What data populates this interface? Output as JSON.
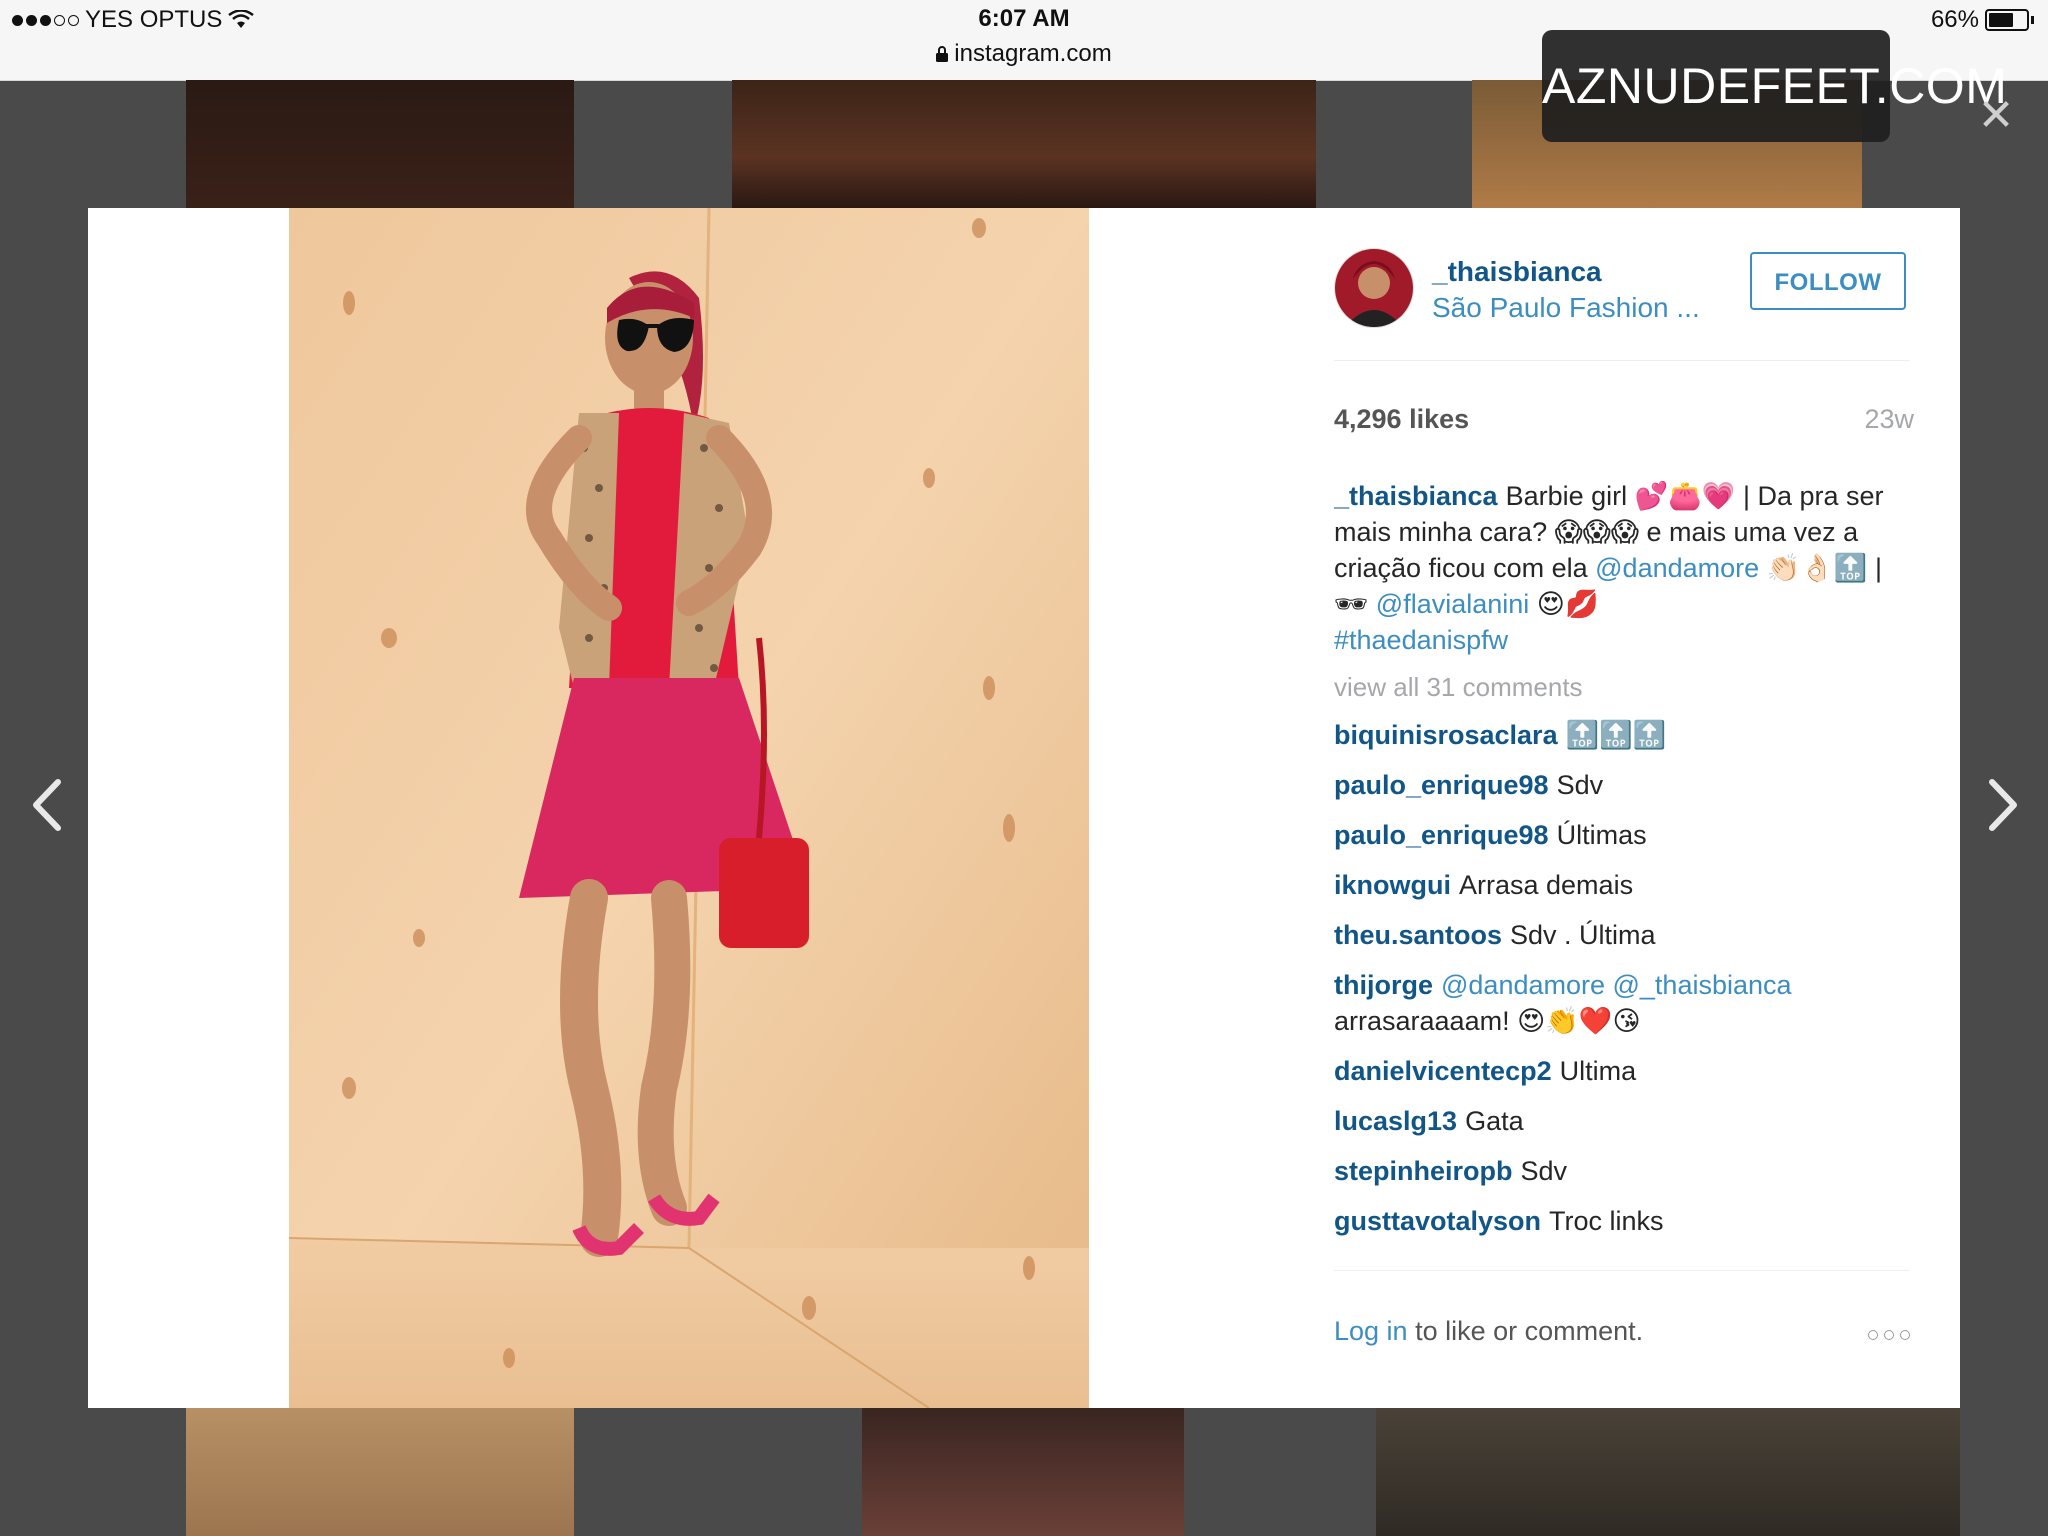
{
  "status_bar": {
    "carrier": "YES OPTUS",
    "time": "6:07 AM",
    "url": "instagram.com",
    "battery": "66%",
    "battery_level": 0.66
  },
  "watermark": "AZNUDEFEET.COM",
  "post": {
    "username": "_thaisbianca",
    "location": "São Paulo Fashion ...",
    "follow_label": "FOLLOW",
    "likes": "4,296 likes",
    "age": "23w",
    "caption": {
      "user": "_thaisbianca",
      "text_1": "Barbie girl 💕👛💗 | Da pra ser mais minha cara? 😱😱😱 e mais uma vez a criação ficou com ela",
      "mention_1": "@dandamore",
      "text_2": "👏🏻👌🏻🔝 | 🕶",
      "mention_2": "@flavialanini",
      "text_3": "😍💋",
      "hashtag": "#thaedanispfw"
    },
    "view_all": "view all 31 comments",
    "comments": [
      {
        "user": "biquinisrosaclara",
        "text": "🔝🔝🔝"
      },
      {
        "user": "paulo_enrique98",
        "text": "Sdv"
      },
      {
        "user": "paulo_enrique98",
        "text": "Últimas"
      },
      {
        "user": "iknowgui",
        "text": "Arrasa demais"
      },
      {
        "user": "theu.santoos",
        "text": "Sdv . Última"
      },
      {
        "user": "thijorge",
        "mention": "@dandamore @_thaisbianca",
        "text": "arrasaraaaam! 😍👏❤️😘"
      },
      {
        "user": "danielvicentecp2",
        "text": "Ultima"
      },
      {
        "user": "lucaslg13",
        "text": "Gata"
      },
      {
        "user": "stepinheiropb",
        "text": "Sdv"
      },
      {
        "user": "gusttavotalyson",
        "text": "Troc links"
      }
    ],
    "login_link": "Log in",
    "login_rest": "to like or comment."
  },
  "icons": {
    "prev": "chevron-left-icon",
    "next": "chevron-right-icon",
    "close": "close-icon",
    "more": "more-options-icon",
    "wifi": "wifi-icon",
    "lock": "lock-icon",
    "battery": "battery-icon"
  }
}
